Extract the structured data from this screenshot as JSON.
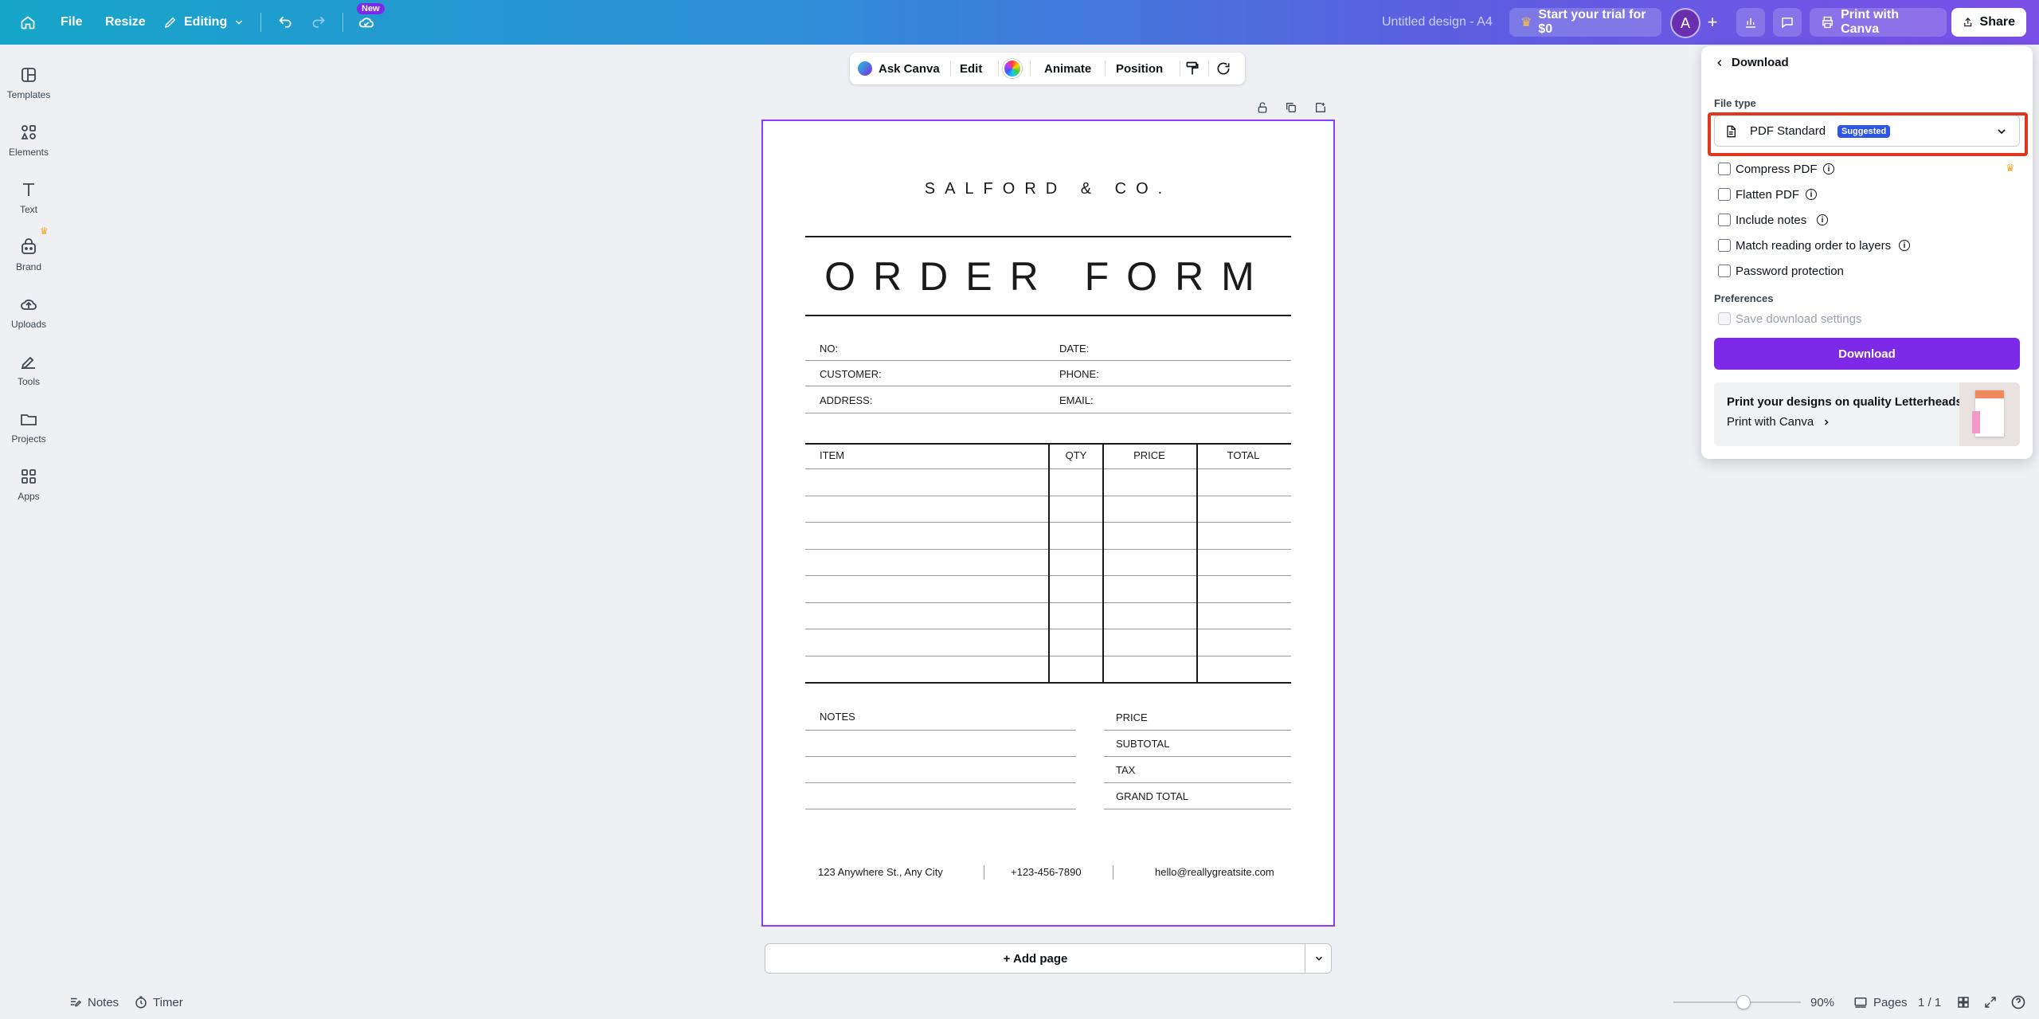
{
  "topbar": {
    "file": "File",
    "resize": "Resize",
    "editing": "Editing",
    "new_badge": "New",
    "design_title": "Untitled design - A4",
    "trial": "Start your trial for $0",
    "avatar_initial": "A",
    "print": "Print with Canva",
    "share": "Share"
  },
  "sidebar": {
    "items": [
      {
        "label": "Templates",
        "icon": "templates-icon"
      },
      {
        "label": "Elements",
        "icon": "elements-icon"
      },
      {
        "label": "Text",
        "icon": "text-icon"
      },
      {
        "label": "Brand",
        "icon": "brand-icon"
      },
      {
        "label": "Uploads",
        "icon": "uploads-icon"
      },
      {
        "label": "Tools",
        "icon": "tools-icon"
      },
      {
        "label": "Projects",
        "icon": "projects-icon"
      },
      {
        "label": "Apps",
        "icon": "apps-icon"
      }
    ]
  },
  "toolbar": {
    "ask": "Ask Canva",
    "edit": "Edit",
    "animate": "Animate",
    "position": "Position"
  },
  "document": {
    "company": "SALFORD & CO.",
    "title": "ORDER FORM",
    "fields": {
      "no": "NO:",
      "date": "DATE:",
      "customer": "CUSTOMER:",
      "phone": "PHONE:",
      "address": "ADDRESS:",
      "email": "EMAIL:"
    },
    "table_headers": [
      "ITEM",
      "QTY",
      "PRICE",
      "TOTAL"
    ],
    "notes": "NOTES",
    "summary": [
      "PRICE",
      "SUBTOTAL",
      "TAX",
      "GRAND TOTAL"
    ],
    "footer": {
      "address": "123 Anywhere St., Any City",
      "phone": "+123-456-7890",
      "email": "hello@reallygreatsite.com"
    }
  },
  "add_page": "+ Add page",
  "download_panel": {
    "title": "Download",
    "file_type_label": "File type",
    "file_type_value": "PDF Standard",
    "suggested": "Suggested",
    "options": [
      "Compress PDF",
      "Flatten PDF",
      "Include notes",
      "Match reading order to layers",
      "Password protection"
    ],
    "preferences_label": "Preferences",
    "save_settings": "Save download settings",
    "download_button": "Download",
    "promo_title": "Print your designs on quality Letterheads",
    "promo_link": "Print with Canva"
  },
  "bottombar": {
    "notes": "Notes",
    "timer": "Timer",
    "zoom": "90%",
    "pages": "Pages",
    "page_count": "1 / 1"
  },
  "colors": {
    "accent": "#7d2ae8",
    "selection": "#8b3dff",
    "highlight": "#e0361d"
  }
}
